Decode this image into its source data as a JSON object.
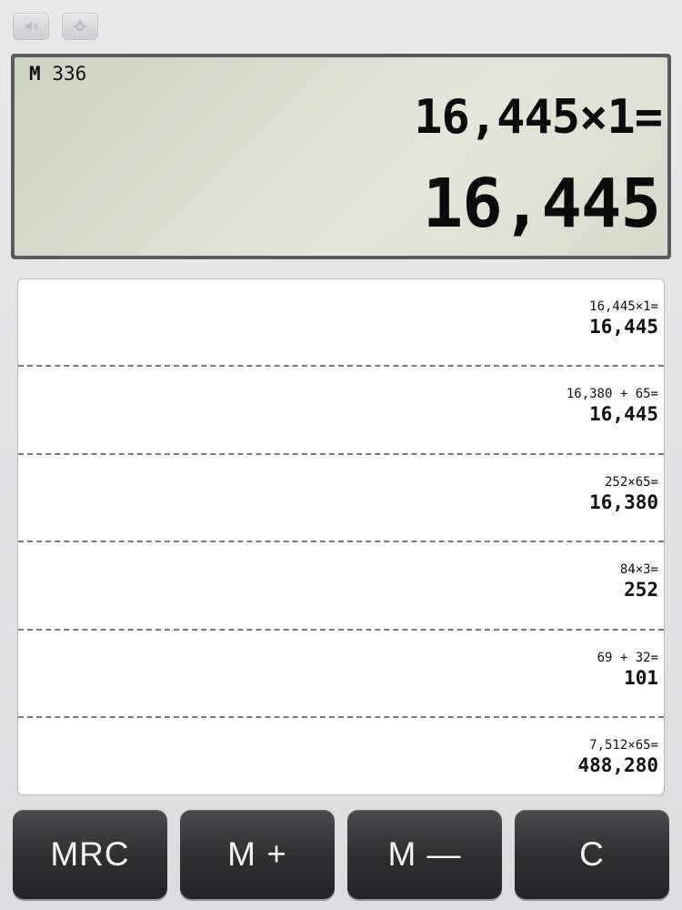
{
  "toolbar": {
    "sound_icon": "speaker-icon",
    "settings_icon": "gear-icon"
  },
  "display": {
    "memory_indicator": "M",
    "memory_value": "336",
    "expression": "16,445×1=",
    "result": "16,445"
  },
  "tape": {
    "entries": [
      {
        "expression": "16,445×1=",
        "result": "16,445"
      },
      {
        "expression": "16,380 + 65=",
        "result": "16,445"
      },
      {
        "expression": "252×65=",
        "result": "16,380"
      },
      {
        "expression": "84×3=",
        "result": "252"
      },
      {
        "expression": "69 + 32=",
        "result": "101"
      },
      {
        "expression": "7,512×65=",
        "result": "488,280"
      }
    ]
  },
  "keys": {
    "mrc": "MRC",
    "m_plus": "M +",
    "m_minus": "M —",
    "clear": "C"
  },
  "colors": {
    "lcd_bg": "#dde0d2",
    "key_bg": "#2e2e30",
    "key_text": "#f4f4f4"
  }
}
